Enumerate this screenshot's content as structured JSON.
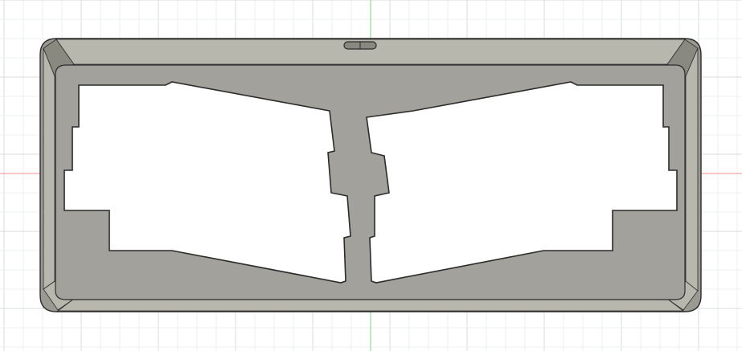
{
  "app": {
    "view": "top",
    "background_color": "#ffffff"
  },
  "grid": {
    "visible": true,
    "minor_color": "#eef0f2",
    "major_color": "#d8dbdf"
  },
  "axes": {
    "x_axis_color": "#f08a8a",
    "y_axis_color": "#7fd27f"
  },
  "model": {
    "type": "keyboard-case-plate",
    "body_color": "#9b9a92",
    "top_face_color": "#a2a19b",
    "chamfer_light": "#b8b7ad",
    "chamfer_dark": "#8a8980",
    "edge_color": "#2b2b2b",
    "halves": 2,
    "features": [
      "outer-frame",
      "inner-plate",
      "left-cutout",
      "right-cutout",
      "center-zigzag-bridge",
      "top-slot"
    ]
  }
}
